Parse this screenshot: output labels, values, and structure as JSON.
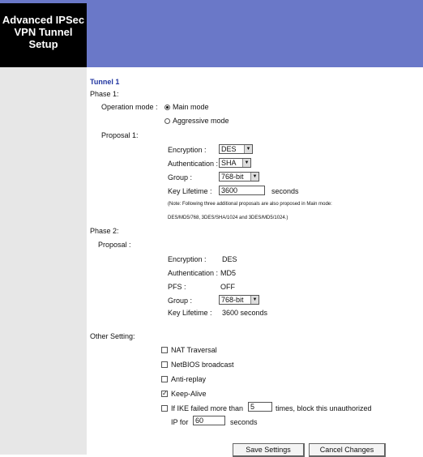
{
  "sidebar": {
    "title_lines": [
      "Advanced IPSec",
      "VPN Tunnel",
      "Setup"
    ]
  },
  "tunnel": {
    "title": "Tunnel 1"
  },
  "phase1": {
    "label": "Phase 1:",
    "operation_mode_label": "Operation mode :",
    "main_mode_label": "Main mode",
    "aggressive_mode_label": "Aggressive mode",
    "selected_mode": "Main mode",
    "proposal_label": "Proposal 1:",
    "encryption_label": "Encryption :",
    "encryption_value": "DES",
    "authentication_label": "Authentication :",
    "authentication_value": "SHA",
    "group_label": "Group :",
    "group_value": "768-bit",
    "key_lifetime_label": "Key Lifetime :",
    "key_lifetime_value": "3600",
    "key_lifetime_unit": "seconds",
    "note_line1": "(Note: Following three additional proposals are also proposed in Main mode:",
    "note_line2": "DES/MD5/768, 3DES/SHA/1024 and 3DES/MD5/1024.)"
  },
  "phase2": {
    "label": "Phase 2:",
    "proposal_label": "Proposal :",
    "encryption_label": "Encryption :",
    "encryption_value": "DES",
    "authentication_label": "Authentication :",
    "authentication_value": "MD5",
    "pfs_label": "PFS :",
    "pfs_value": "OFF",
    "group_label": "Group :",
    "group_value": "768-bit",
    "key_lifetime_label": "Key Lifetime :",
    "key_lifetime_value": "3600 seconds"
  },
  "other": {
    "label": "Other Setting:",
    "nat_traversal_label": "NAT Traversal",
    "nat_traversal_checked": false,
    "netbios_label": "NetBIOS broadcast",
    "netbios_checked": false,
    "anti_replay_label": "Anti-replay",
    "anti_replay_checked": false,
    "keep_alive_label": "Keep-Alive",
    "keep_alive_checked": true,
    "ike_fail_label": "If IKE failed more than",
    "ike_fail_checked": false,
    "ike_fail_times": "5",
    "ike_fail_suffix": "times, block this unauthorized",
    "ip_for_label": "IP for",
    "ip_for_seconds": "60",
    "ip_for_unit": "seconds",
    "check_mark": "✓"
  },
  "buttons": {
    "save_label": "Save Settings",
    "cancel_label": "Cancel Changes"
  },
  "icons": {
    "dropdown_arrow": "▼"
  },
  "colors": {
    "header_blue": "#6a78c8",
    "title_blue": "#2035a0",
    "sidebar_gray": "#e7e7e7"
  }
}
